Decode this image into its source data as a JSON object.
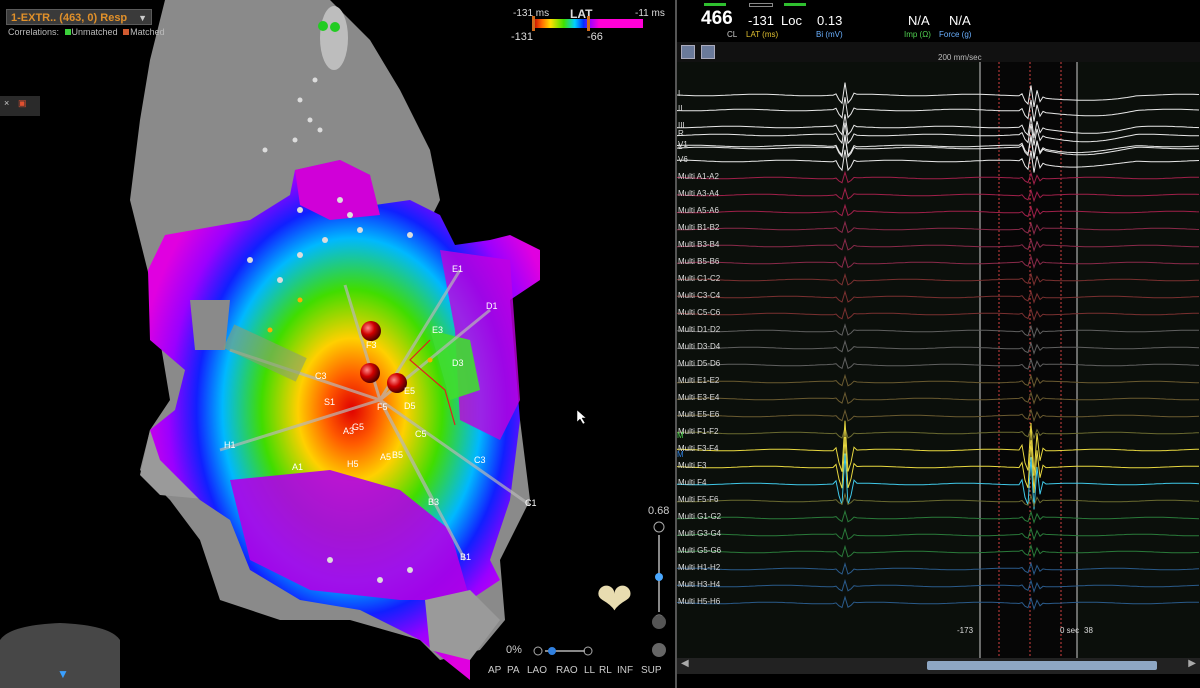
{
  "map": {
    "name": "1-EXTR.. (463, 0) Resp",
    "correlations_label": "Correlations:",
    "unmatched": "Unmatched",
    "matched": "Matched",
    "unmatched_color": "#3bd13b",
    "matched_color": "#d05a30",
    "electrodes": [
      "E1",
      "D1",
      "E3",
      "F3",
      "D3",
      "C3",
      "F5",
      "E5",
      "D5",
      "S1",
      "G5",
      "A3",
      "C5",
      "A5",
      "B5",
      "H5",
      "C3",
      "C1",
      "B3",
      "B1",
      "H1",
      "A1"
    ],
    "zoom_value": "0.68",
    "zoom_percent": "0%",
    "views": [
      "AP",
      "PA",
      "LAO",
      "RAO",
      "LL",
      "RL",
      "INF",
      "SUP"
    ],
    "heart_icon": "heart-icon",
    "compass_icon": "navigation-compass-icon"
  },
  "lat_scale": {
    "title": "LAT",
    "min_ms": "-131 ms",
    "max_ms": "-11 ms",
    "low": "-131",
    "high": "-66"
  },
  "ecg": {
    "cl_value": "466",
    "cl_label": "CL",
    "lat_value": "-131",
    "lat_label": "LAT (ms)",
    "loc": "Loc",
    "bi_value": "0.13",
    "bi_label": "Bi (mV)",
    "imp_value": "N/A",
    "imp_label": "Imp (Ω)",
    "force_value": "N/A",
    "force_label": "Force (g)",
    "speed": "200 mm/sec",
    "leads": [
      "I",
      "II",
      "III",
      "R",
      "L",
      "V1",
      "V6",
      "Multi A1-A2",
      "Multi A3-A4",
      "Multi A5-A6",
      "Multi B1-B2",
      "Multi B3-B4",
      "Multi B5-B6",
      "Multi C1-C2",
      "Multi C3-C4",
      "Multi C5-C6",
      "Multi D1-D2",
      "Multi D3-D4",
      "Multi D5-D6",
      "Multi E1-E2",
      "Multi E3-E4",
      "Multi E5-E6",
      "Multi F1-F2",
      "Multi F3-F4",
      "Multi F3",
      "Multi F4",
      "Multi F5-F6",
      "Multi G1-G2",
      "Multi G3-G4",
      "Multi G5-G6",
      "Multi H1-H2",
      "Multi H3-H4",
      "Multi H5-H6"
    ],
    "timeline_left": "-173",
    "timeline_zero": "0 sec",
    "timeline_right": "38",
    "marker_m": "M"
  }
}
